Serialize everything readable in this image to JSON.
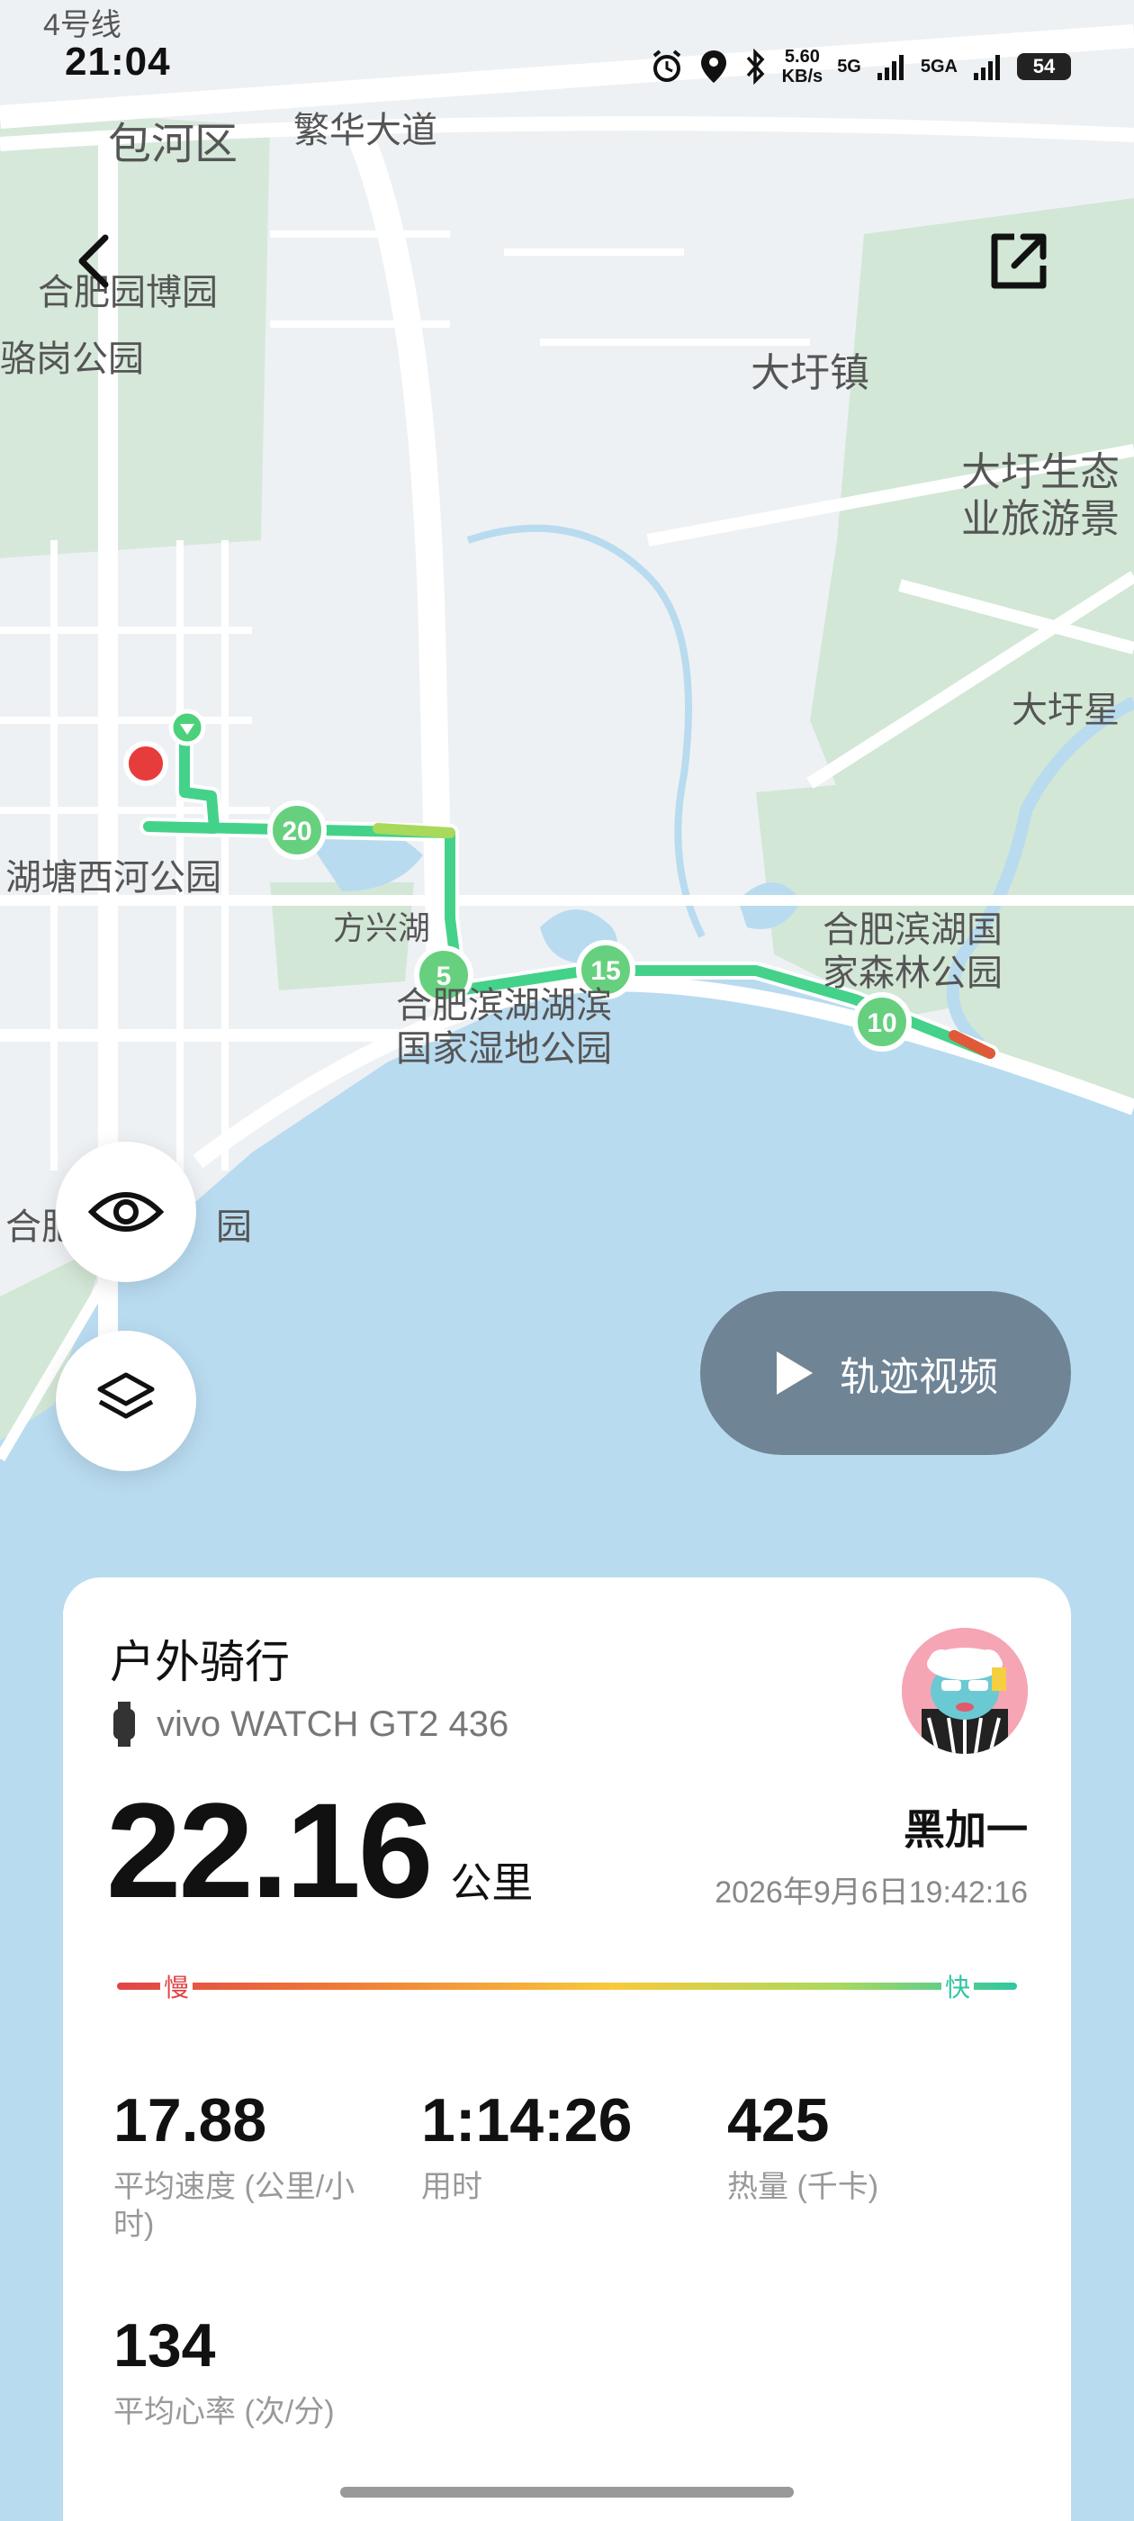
{
  "status_bar": {
    "time": "21:04",
    "net_speed": "5.60",
    "net_unit": "KB/s",
    "signal1": "5G",
    "signal2": "5GA",
    "battery": "54"
  },
  "map": {
    "labels": [
      "4号线",
      "包河区",
      "繁华大道",
      "合肥园博园",
      "骆岗公园",
      "大圩镇",
      "大圩生态",
      "业旅游景",
      "大圩星",
      "湖塘西河公园",
      "方兴湖",
      "合肥滨湖国",
      "家森林公园",
      "合肥滨湖湖滨",
      "国家湿地公园",
      "合肥",
      "园"
    ],
    "km_markers": [
      "20",
      "5",
      "15",
      "10"
    ],
    "colors": {
      "water": "#b9dbf0",
      "green": "#d3e7d6",
      "route": "#44d18a",
      "start": "#4cd07a",
      "end": "#e63c3c"
    }
  },
  "actions": {
    "back_icon": "chevron-left-icon",
    "share_icon": "external-link-icon",
    "eye_icon": "eye-icon",
    "layers_icon": "layers-icon",
    "video_label": "轨迹视频"
  },
  "card": {
    "title": "户外骑行",
    "device": "vivo WATCH GT2 436",
    "distance_value": "22.16",
    "distance_unit": "公里",
    "user_name": "黑加一",
    "datetime": "2026年9月6日19:42:16",
    "legend_slow": "慢",
    "legend_fast": "快",
    "stats": [
      {
        "value": "17.88",
        "label": "平均速度 (公里/小时)"
      },
      {
        "value": "1:14:26",
        "label": "用时"
      },
      {
        "value": "425",
        "label": "热量 (千卡)"
      },
      {
        "value": "134",
        "label": "平均心率 (次/分)"
      }
    ]
  }
}
